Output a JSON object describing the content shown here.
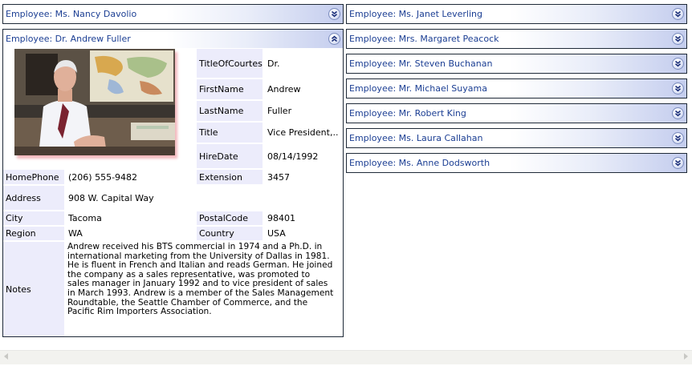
{
  "collapsed_left": {
    "title": "Employee: Ms. Nancy Davolio"
  },
  "expanded": {
    "title": "Employee: Dr. Andrew Fuller",
    "fields": {
      "title_of_courtesy": {
        "label": "TitleOfCourtesy",
        "value": "Dr."
      },
      "first_name": {
        "label": "FirstName",
        "value": "Andrew"
      },
      "last_name": {
        "label": "LastName",
        "value": "Fuller"
      },
      "title": {
        "label": "Title",
        "value": "Vice President,..."
      },
      "hire_date": {
        "label": "HireDate",
        "value": "08/14/1992"
      },
      "home_phone": {
        "label": "HomePhone",
        "value": "(206) 555-9482"
      },
      "extension": {
        "label": "Extension",
        "value": "3457"
      },
      "address": {
        "label": "Address",
        "value": "908 W. Capital Way"
      },
      "city": {
        "label": "City",
        "value": "Tacoma"
      },
      "postal_code": {
        "label": "PostalCode",
        "value": "98401"
      },
      "region": {
        "label": "Region",
        "value": "WA"
      },
      "country": {
        "label": "Country",
        "value": "USA"
      },
      "notes": {
        "label": "Notes",
        "value": "Andrew received his BTS commercial in 1974 and a Ph.D. in international marketing from the University of Dallas in 1981.  He is fluent in French and Italian and reads German.  He joined the company as a sales representative, was promoted to sales manager in January 1992 and to vice president of sales in March 1993.  Andrew is a member of the Sales Management Roundtable, the Seattle Chamber of Commerce, and the Pacific Rim Importers Association."
      }
    }
  },
  "collapsed_right": [
    {
      "title": "Employee: Ms. Janet Leverling"
    },
    {
      "title": "Employee: Mrs. Margaret Peacock"
    },
    {
      "title": "Employee: Mr. Steven Buchanan"
    },
    {
      "title": "Employee: Mr. Michael Suyama"
    },
    {
      "title": "Employee: Mr. Robert King"
    },
    {
      "title": "Employee: Ms. Laura Callahan"
    },
    {
      "title": "Employee: Ms. Anne Dodsworth"
    }
  ],
  "icons": {
    "expand": "chevron-double-down-icon",
    "collapse": "chevron-double-up-icon",
    "photo": "employee-photo"
  },
  "colors": {
    "header_text": "#1b3e93",
    "label_background": "#ececfb",
    "panel_border": "#1f2a38"
  }
}
